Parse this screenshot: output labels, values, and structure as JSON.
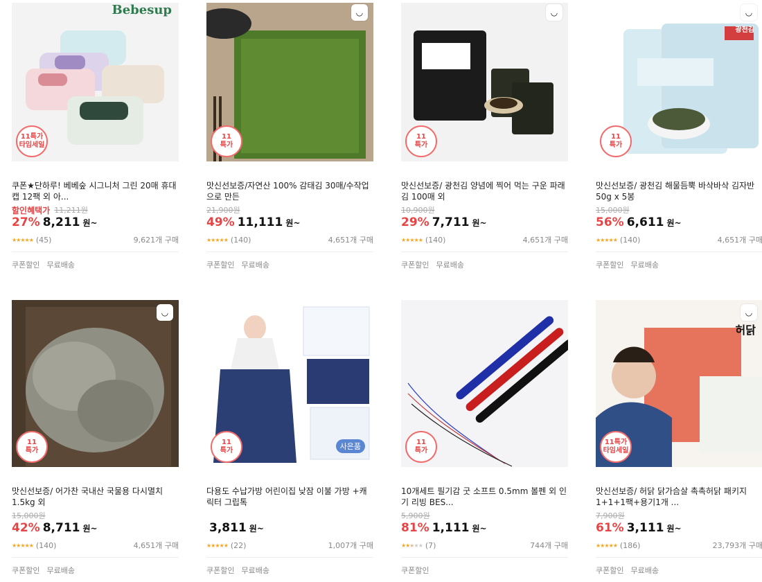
{
  "products": [
    {
      "title": "쿠폰★단하루! 베베숲 시그니처 그린 20매 휴대 캡 12팩 외 아...",
      "benefit": "할인혜택가",
      "original": "11,211원",
      "discount": "27%",
      "price": "8,211",
      "won": "원~",
      "stars": "★★★★★",
      "rating": 5,
      "reviews": "(45)",
      "sold": "9,621개 구매",
      "tags": [
        "쿠폰할인",
        "무료배송"
      ],
      "badge_line1": "11특가",
      "badge_line2": "타임세일",
      "brand": "Bebesup",
      "image": "wipes-packs-image"
    },
    {
      "title": "맛신선보증/자연산 100% 감태김 30매/수작업으로 만든",
      "benefit": "",
      "original": "21,900원",
      "discount": "49%",
      "price": "11,111",
      "won": "원~",
      "stars": "★★★★★",
      "rating": 4.5,
      "reviews": "(140)",
      "sold": "4,651개 구매",
      "tags": [
        "쿠폰할인",
        "무료배송"
      ],
      "badge_line1": "11",
      "badge_line2": "특가",
      "brand": "",
      "image": "green-seaweed-image"
    },
    {
      "title": "맛신선보증/ 광천김 양념에 찍어 먹는 구운 파래김 100매 외",
      "benefit": "",
      "original": "10,900원",
      "discount": "29%",
      "price": "7,711",
      "won": "원~",
      "stars": "★★★★★",
      "rating": 4.5,
      "reviews": "(140)",
      "sold": "4,651개 구매",
      "tags": [
        "쿠폰할인",
        "무료배송"
      ],
      "badge_line1": "11",
      "badge_line2": "특가",
      "brand": "",
      "image": "roasted-laver-image"
    },
    {
      "title": "맛신선보증/ 광천김 해물듬뿍 바삭바삭 김자반 50g x 5봉",
      "benefit": "",
      "original": "15,000원",
      "discount": "56%",
      "price": "6,611",
      "won": "원~",
      "stars": "★★★★★",
      "rating": 4.5,
      "reviews": "(140)",
      "sold": "4,651개 구매",
      "tags": [
        "쿠폰할인",
        "무료배송"
      ],
      "badge_line1": "11",
      "badge_line2": "특가",
      "brand": "광천김",
      "image": "gimjaban-bag-image"
    },
    {
      "title": "맛신선보증/ 어가찬 국내산 국물용 다시멸치 1.5kg 외",
      "benefit": "",
      "original": "15,000원",
      "discount": "42%",
      "price": "8,711",
      "won": "원~",
      "stars": "★★★★★",
      "rating": 4.5,
      "reviews": "(140)",
      "sold": "4,651개 구매",
      "tags": [
        "쿠폰할인",
        "무료배송"
      ],
      "badge_line1": "11",
      "badge_line2": "특가",
      "brand": "",
      "image": "dried-anchovy-image"
    },
    {
      "title": "다용도 수납가방 어린이집 낮잠 이불 가방 +캐릭터 그립톡",
      "benefit": "",
      "original": "",
      "discount": "",
      "price": "3,811",
      "won": "원~",
      "stars": "★★★★★",
      "rating": 4.5,
      "reviews": "(22)",
      "sold": "1,007개 구매",
      "tags": [
        "쿠폰할인",
        "무료배송"
      ],
      "badge_line1": "11",
      "badge_line2": "특가",
      "gift": "사은품",
      "brand": "",
      "image": "storage-bag-image"
    },
    {
      "title": "10개세트 필기감 굿 소프트 0.5mm 볼펜 외 인기 리빙 BES...",
      "benefit": "",
      "original": "5,900원",
      "discount": "81%",
      "price": "1,111",
      "won": "원~",
      "stars": "★★★★★",
      "rating": 2.5,
      "reviews": "(7)",
      "sold": "744개 구매",
      "tags": [
        "쿠폰할인"
      ],
      "badge_line1": "11",
      "badge_line2": "특가",
      "brand": "",
      "image": "ballpoint-pens-image"
    },
    {
      "title": "맛신선보증/ 허닭 닭가슴살 촉촉허닭 패키지 1+1+1팩+용기1개 ...",
      "benefit": "",
      "original": "7,900원",
      "discount": "61%",
      "price": "3,111",
      "won": "원~",
      "stars": "★★★★★",
      "rating": 4.5,
      "reviews": "(186)",
      "sold": "23,793개 구매",
      "tags": [
        "쿠폰할인",
        "무료배송"
      ],
      "badge_line1": "11특가",
      "badge_line2": "타임세일",
      "brand": "허닭",
      "image": "chicken-breast-ad-image"
    }
  ]
}
